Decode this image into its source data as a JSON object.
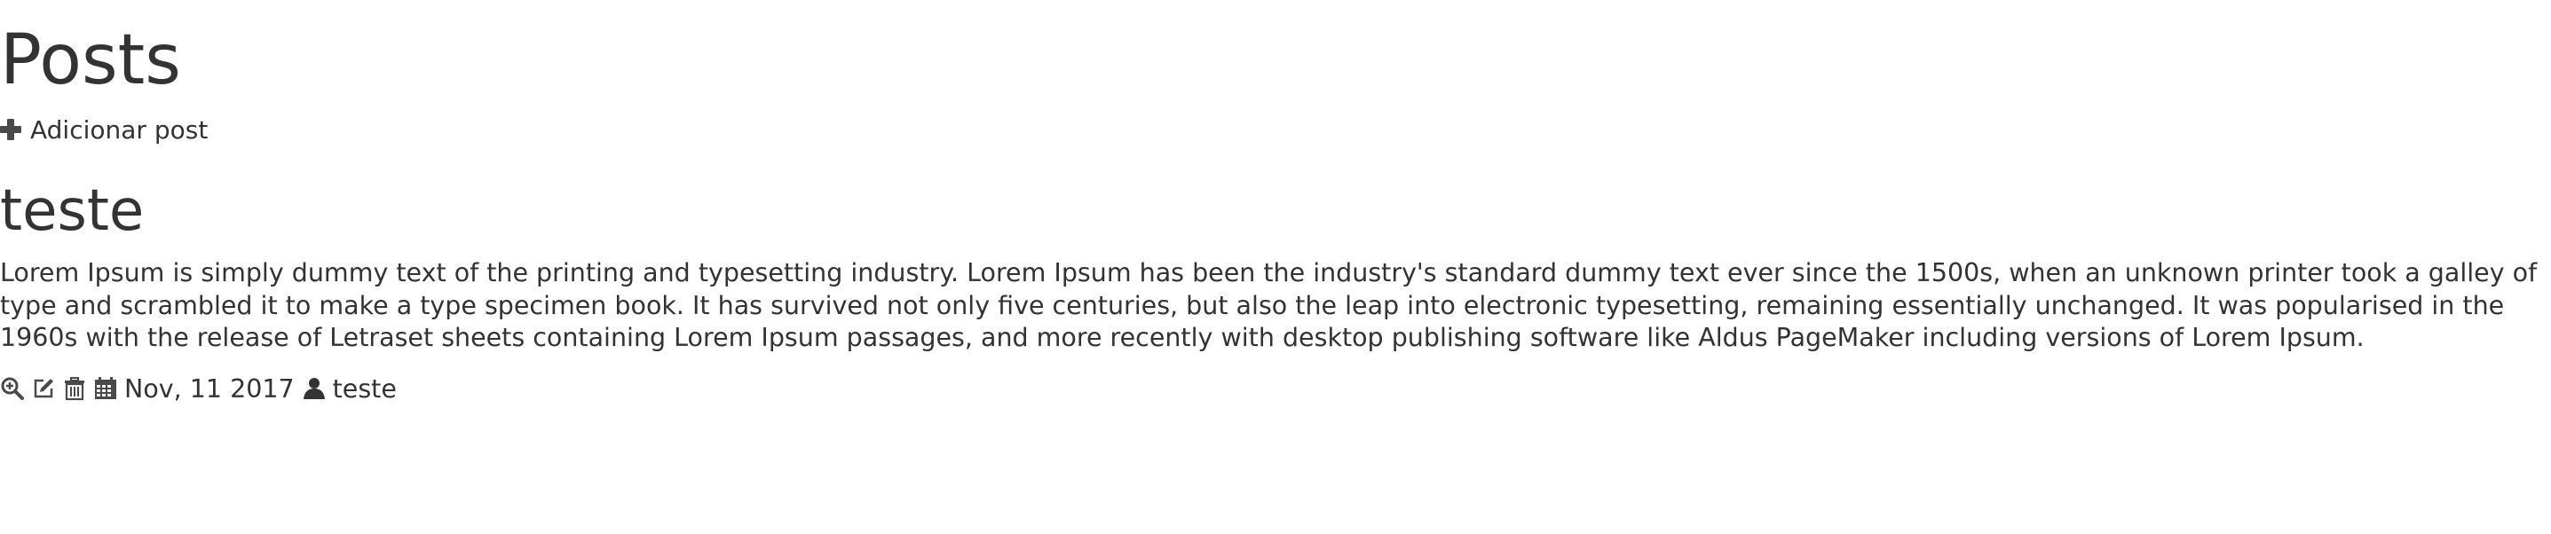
{
  "page": {
    "title": "Posts",
    "add_post_label": "Adicionar post"
  },
  "post": {
    "title": "teste",
    "body": "Lorem Ipsum is simply dummy text of the printing and typesetting industry. Lorem Ipsum has been the industry's standard dummy text ever since the 1500s, when an unknown printer took a galley of type and scrambled it to make a type specimen book. It has survived not only five centuries, but also the leap into electronic typesetting, remaining essentially unchanged. It was popularised in the 1960s with the release of Letraset sheets containing Lorem Ipsum passages, and more recently with desktop publishing software like Aldus PageMaker including versions of Lorem Ipsum.",
    "date": "Nov, 11 2017",
    "author": "teste"
  },
  "icons": {
    "add": "plus-icon",
    "view": "zoom-in-icon",
    "edit": "edit-icon",
    "delete": "trash-icon",
    "date": "calendar-icon",
    "author": "user-icon"
  },
  "colors": {
    "text": "#333333",
    "icon": "#4a4a4a",
    "background": "#ffffff"
  }
}
